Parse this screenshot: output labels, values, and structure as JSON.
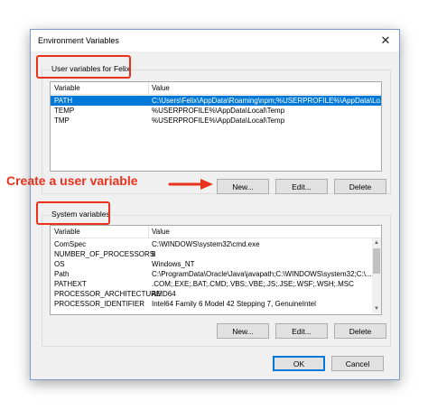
{
  "window": {
    "title": "Environment Variables"
  },
  "user_group": {
    "label": "User variables for Felix",
    "columns": [
      "Variable",
      "Value"
    ],
    "rows": [
      {
        "variable": "PATH",
        "value": "C:\\Users\\Felix\\AppData\\Roaming\\npm;%USERPROFILE%\\AppData\\Lo...",
        "selected": true
      },
      {
        "variable": "TEMP",
        "value": "%USERPROFILE%\\AppData\\Local\\Temp"
      },
      {
        "variable": "TMP",
        "value": "%USERPROFILE%\\AppData\\Local\\Temp"
      }
    ],
    "buttons": {
      "new": "New...",
      "edit": "Edit...",
      "delete": "Delete"
    }
  },
  "annotation": {
    "text": "Create a user variable"
  },
  "system_group": {
    "label": "System variables",
    "columns": [
      "Variable",
      "Value"
    ],
    "rows": [
      {
        "variable": "ComSpec",
        "value": "C:\\WINDOWS\\system32\\cmd.exe"
      },
      {
        "variable": "NUMBER_OF_PROCESSORS",
        "value": "8"
      },
      {
        "variable": "OS",
        "value": "Windows_NT"
      },
      {
        "variable": "Path",
        "value": "C:\\ProgramData\\Oracle\\Java\\javapath;C:\\WINDOWS\\system32;C:\\..."
      },
      {
        "variable": "PATHEXT",
        "value": ".COM;.EXE;.BAT;.CMD;.VBS;.VBE;.JS;.JSE;.WSF;.WSH;.MSC"
      },
      {
        "variable": "PROCESSOR_ARCHITECTURE",
        "value": "AMD64"
      },
      {
        "variable": "PROCESSOR_IDENTIFIER",
        "value": "Intel64 Family 6 Model 42 Stepping 7, GenuineIntel"
      }
    ],
    "buttons": {
      "new": "New...",
      "edit": "Edit...",
      "delete": "Delete"
    }
  },
  "dialog_buttons": {
    "ok": "OK",
    "cancel": "Cancel"
  },
  "colors": {
    "annotation": "#e8321e",
    "selection": "#0078d7"
  },
  "icons": {
    "close": "close-icon",
    "arrow": "arrow-right-icon"
  }
}
